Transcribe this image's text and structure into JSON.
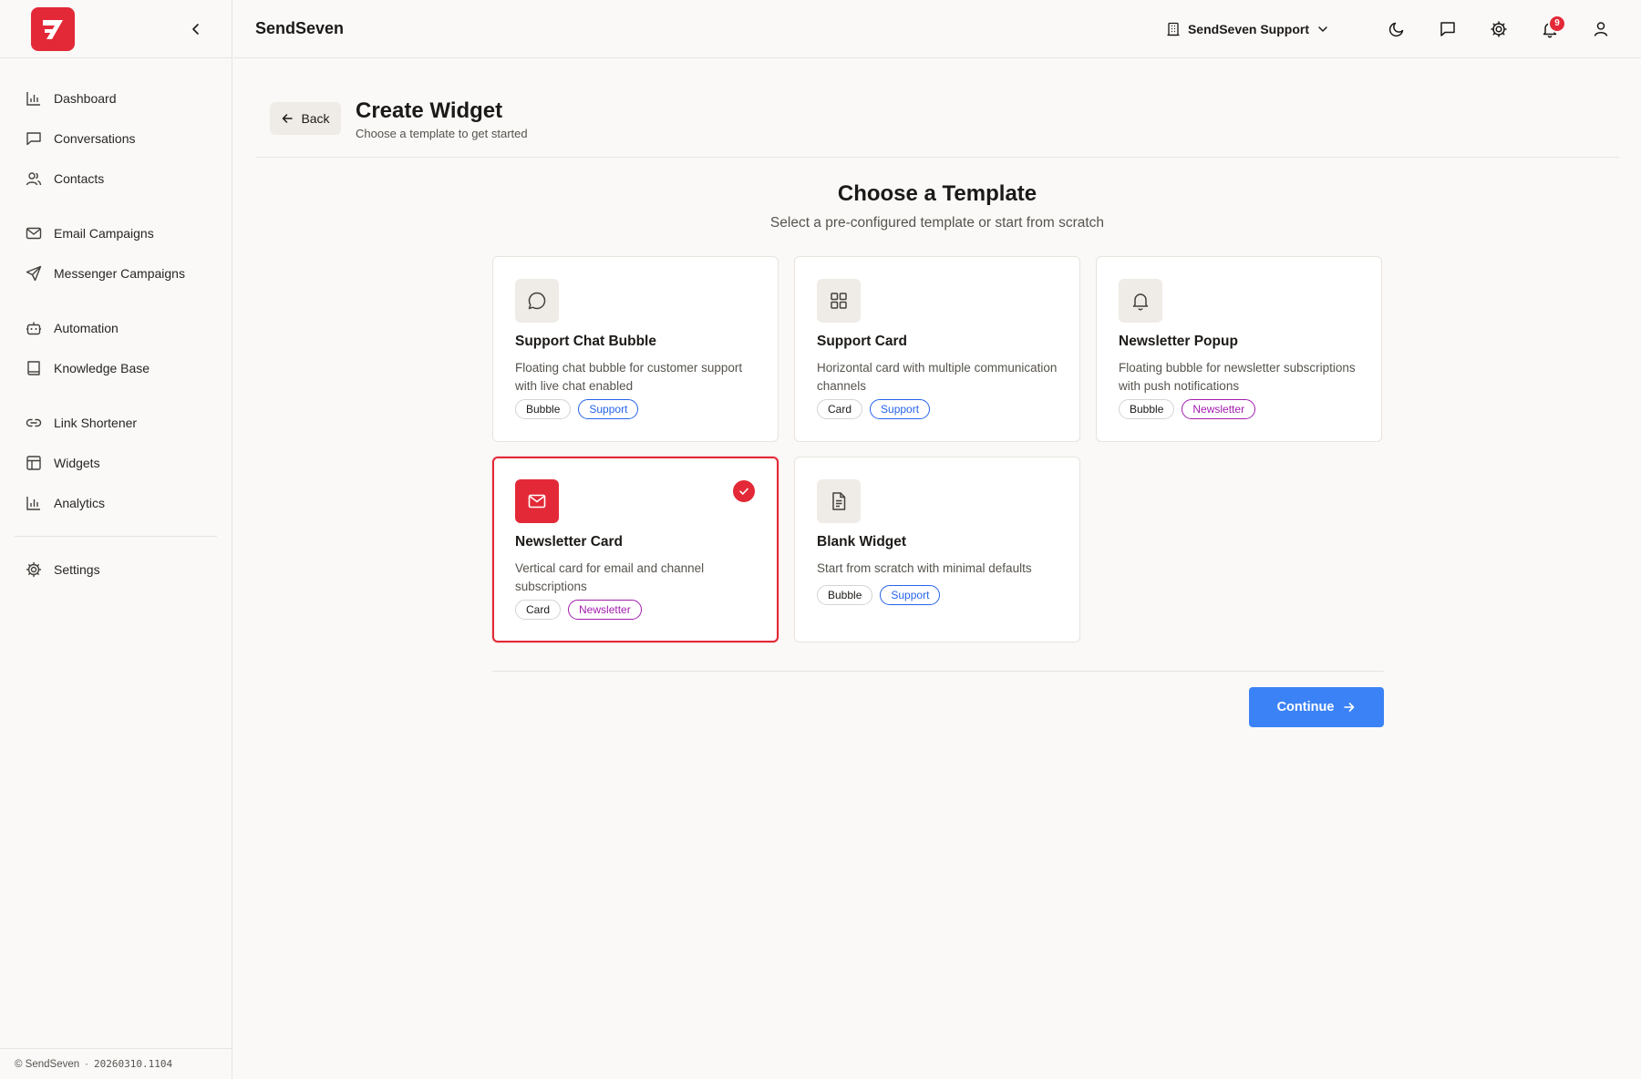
{
  "app": {
    "name": "SendSeven"
  },
  "sidebar": {
    "groups": [
      [
        {
          "label": "Dashboard",
          "icon": "bar-chart-icon"
        },
        {
          "label": "Conversations",
          "icon": "chat-icon"
        },
        {
          "label": "Contacts",
          "icon": "users-icon"
        }
      ],
      [
        {
          "label": "Email Campaigns",
          "icon": "mail-icon"
        },
        {
          "label": "Messenger Campaigns",
          "icon": "send-icon"
        }
      ],
      [
        {
          "label": "Automation",
          "icon": "bot-icon"
        },
        {
          "label": "Knowledge Base",
          "icon": "book-icon"
        }
      ],
      [
        {
          "label": "Link Shortener",
          "icon": "link-icon"
        },
        {
          "label": "Widgets",
          "icon": "layout-icon"
        },
        {
          "label": "Analytics",
          "icon": "bar-chart-icon"
        }
      ]
    ],
    "settings_label": "Settings",
    "footer": {
      "copyright": "© SendSeven",
      "separator": "·",
      "build": "20260310.1104"
    }
  },
  "topbar": {
    "org": "SendSeven Support",
    "notification_count": "9"
  },
  "page": {
    "back_label": "Back",
    "title": "Create Widget",
    "subtitle": "Choose a template to get started"
  },
  "templates_section": {
    "title": "Choose a Template",
    "subtitle": "Select a pre-configured template or start from scratch"
  },
  "templates": [
    {
      "title": "Support Chat Bubble",
      "desc": "Floating chat bubble for customer support with live chat enabled",
      "icon": "message-circle-icon",
      "tags": [
        {
          "label": "Bubble",
          "kind": "neutral"
        },
        {
          "label": "Support",
          "kind": "support"
        }
      ],
      "selected": false
    },
    {
      "title": "Support Card",
      "desc": "Horizontal card with multiple communication channels",
      "icon": "grid-icon",
      "tags": [
        {
          "label": "Card",
          "kind": "neutral"
        },
        {
          "label": "Support",
          "kind": "support"
        }
      ],
      "selected": false
    },
    {
      "title": "Newsletter Popup",
      "desc": "Floating bubble for newsletter subscriptions with push notifications",
      "icon": "bell-icon",
      "tags": [
        {
          "label": "Bubble",
          "kind": "neutral"
        },
        {
          "label": "Newsletter",
          "kind": "newsletter"
        }
      ],
      "selected": false
    },
    {
      "title": "Newsletter Card",
      "desc": "Vertical card for email and channel subscriptions",
      "icon": "mail-icon",
      "tags": [
        {
          "label": "Card",
          "kind": "neutral"
        },
        {
          "label": "Newsletter",
          "kind": "newsletter"
        }
      ],
      "selected": true
    },
    {
      "title": "Blank Widget",
      "desc": "Start from scratch with minimal defaults",
      "icon": "file-icon",
      "tags": [
        {
          "label": "Bubble",
          "kind": "neutral"
        },
        {
          "label": "Support",
          "kind": "support"
        }
      ],
      "selected": false
    }
  ],
  "actions": {
    "continue_label": "Continue"
  },
  "colors": {
    "brand": "#e32937",
    "primary": "#3b82f6",
    "support_tag": "#2563eb",
    "newsletter_tag": "#a21caf"
  }
}
